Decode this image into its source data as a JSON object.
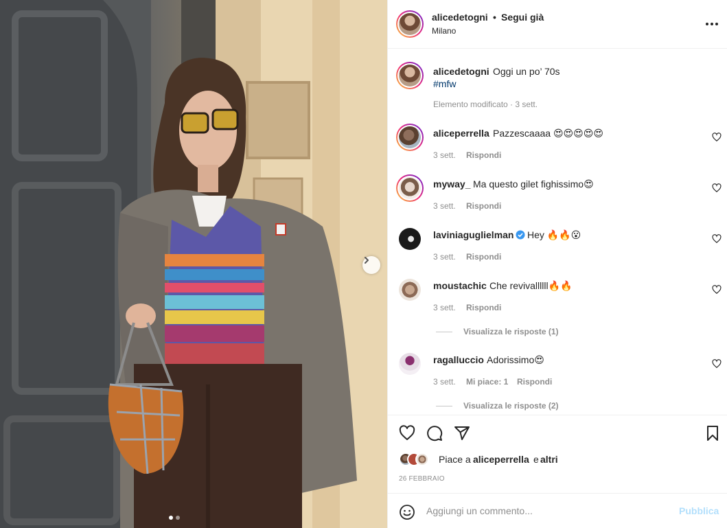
{
  "post": {
    "author": "alicedetogni",
    "separator": "•",
    "follow_state": "Segui già",
    "location": "Milano",
    "caption_text": "Oggi un po’ 70s",
    "hashtag": "#mfw",
    "edited_meta": "Elemento modificato · 3 sett.",
    "carousel": {
      "slides": 2,
      "active_index": 0
    }
  },
  "comments": [
    {
      "user": "aliceperrella",
      "text": "Pazzescaaaa 😍😍😍😍😍",
      "time": "3 sett.",
      "reply": "Rispondi",
      "verified": false,
      "ring": true
    },
    {
      "user": "myway_",
      "text": "Ma questo gilet fighissimo😍",
      "time": "3 sett.",
      "reply": "Rispondi",
      "verified": false,
      "ring": true
    },
    {
      "user": "laviniaguglielman",
      "text": "Hey 🔥🔥😮",
      "time": "3 sett.",
      "reply": "Rispondi",
      "verified": true,
      "ring": false
    },
    {
      "user": "moustachic",
      "text": "Che revivallllll🔥🔥",
      "time": "3 sett.",
      "reply": "Rispondi",
      "verified": false,
      "ring": false,
      "view_replies": "Visualizza le risposte (1)"
    },
    {
      "user": "ragalluccio",
      "text": "Adorissimo😍",
      "time": "3 sett.",
      "likes": "Mi piace: 1",
      "reply": "Rispondi",
      "verified": false,
      "ring": false,
      "view_replies": "Visualizza le risposte (2)"
    }
  ],
  "likes": {
    "prefix": "Piace a",
    "user": "aliceperrella",
    "conjunction": "e",
    "others": "altri"
  },
  "date": "26 FEBBRAIO",
  "composer": {
    "placeholder": "Aggiungi un commento...",
    "publish_label": "Pubblica"
  },
  "colors": {
    "link_blue": "#00376b",
    "publish_disabled": "#b2dffc",
    "verified_blue": "#3897f0",
    "muted": "#8e8e8e"
  },
  "icons": {
    "more": "more-horizontal-icon",
    "like": "heart-icon",
    "comment": "comment-bubble-icon",
    "share": "paper-plane-icon",
    "save": "bookmark-icon",
    "emoji": "smiley-icon",
    "next": "chevron-right-icon"
  }
}
